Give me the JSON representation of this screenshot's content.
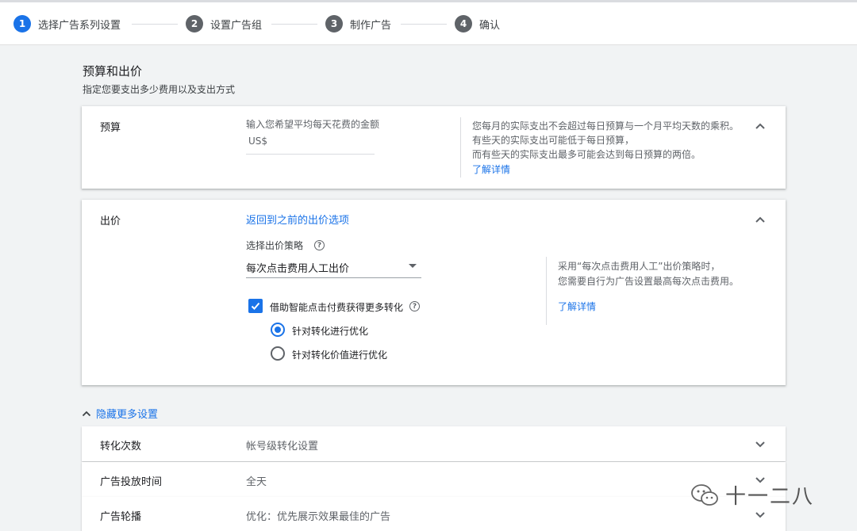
{
  "stepper": {
    "steps": [
      {
        "num": "1",
        "label": "选择广告系列设置"
      },
      {
        "num": "2",
        "label": "设置广告组"
      },
      {
        "num": "3",
        "label": "制作广告"
      },
      {
        "num": "4",
        "label": "确认"
      }
    ]
  },
  "section": {
    "title": "预算和出价",
    "subtitle": "指定您要支出多少费用以及支出方式"
  },
  "budget": {
    "label": "预算",
    "input_prompt": "输入您希望平均每天花费的金额",
    "input_placeholder": "US$",
    "info_line1": "您每月的实际支出不会超过每日预算与一个月平均天数的乘积。",
    "info_line2": "有些天的实际支出可能低于每日预算，",
    "info_line3": "而有些天的实际支出最多可能会达到每日预算的两倍。",
    "learn_more": "了解详情"
  },
  "bidding": {
    "label": "出价",
    "back_link": "返回到之前的出价选项",
    "strategy_label": "选择出价策略",
    "strategy_value": "每次点击费用人工出价",
    "enhanced_cpc_label": "借助智能点击付费获得更多转化",
    "radio_conversions": "针对转化进行优化",
    "radio_conversion_value": "针对转化价值进行优化",
    "info_line1": "采用“每次点击费用人工”出价策略时，",
    "info_line2": "您需要自行为广告设置最高每次点击费用。",
    "learn_more": "了解详情"
  },
  "more_settings": {
    "toggle_label": "隐藏更多设置",
    "rows": [
      {
        "label": "转化次数",
        "value": "帐号级转化设置"
      },
      {
        "label": "广告投放时间",
        "value": "全天"
      },
      {
        "label": "广告轮播",
        "value": "优化：优先展示效果最佳的广告"
      }
    ]
  },
  "watermark": {
    "text": "十一二八"
  },
  "colors": {
    "accent": "#1a73e8",
    "background": "#f1f3f4",
    "step_inactive": "#5f6368"
  }
}
